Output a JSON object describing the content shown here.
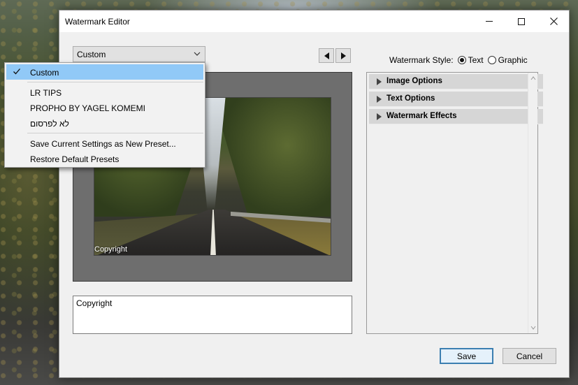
{
  "window": {
    "title": "Watermark Editor"
  },
  "preset": {
    "selected": "Custom",
    "menu_items": [
      "Custom",
      "LR TIPS",
      "PROPHO BY YAGEL KOMEMI",
      "לא לפרסום",
      "Save Current Settings as New Preset...",
      "Restore Default Presets"
    ]
  },
  "preview": {
    "watermark_text": "Copyright"
  },
  "text_input": {
    "value": "Copyright"
  },
  "style": {
    "label": "Watermark Style:",
    "options": [
      "Text",
      "Graphic"
    ],
    "selected": "Text"
  },
  "panels": [
    "Image Options",
    "Text Options",
    "Watermark Effects"
  ],
  "buttons": {
    "save": "Save",
    "cancel": "Cancel"
  },
  "colors": {
    "menu_highlight": "#91c9f7",
    "focus_border": "#3c7fb1"
  },
  "icons": {
    "minimize": "minimize-icon",
    "maximize": "maximize-icon",
    "close": "close-icon",
    "dropdown": "chevron-down-icon",
    "prev": "triangle-left-icon",
    "next": "triangle-right-icon",
    "check": "check-icon",
    "expand": "triangle-right-icon"
  }
}
